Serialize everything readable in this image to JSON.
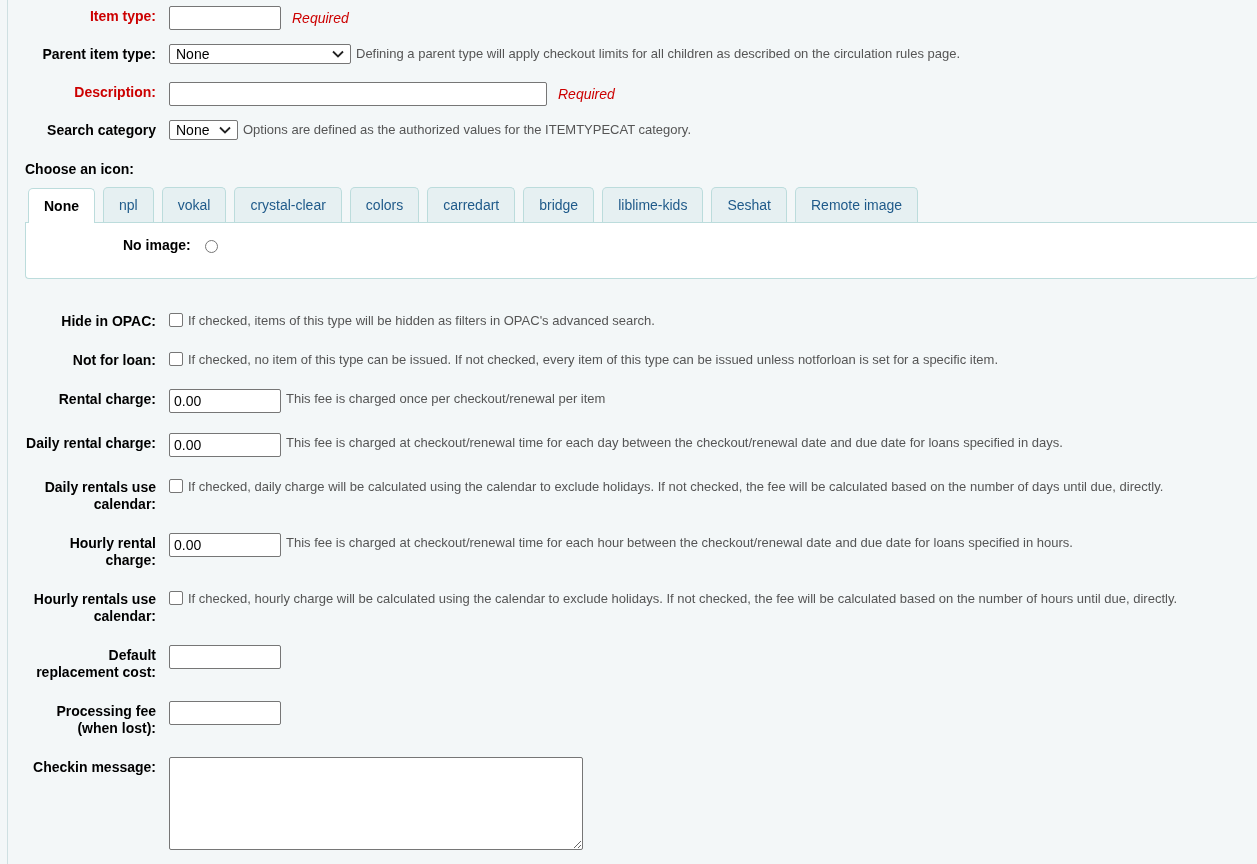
{
  "top_fields": [
    {
      "kind": "text",
      "label": "Item type:",
      "required": true,
      "note": "Required"
    },
    {
      "kind": "select",
      "label": "Parent item type:",
      "required": false,
      "value": "None",
      "hint": "Defining a parent type will apply checkout limits for all children as described on the circulation rules page."
    },
    {
      "kind": "text",
      "label": "Description:",
      "required": true,
      "note": "Required"
    },
    {
      "kind": "select",
      "label": "Search category",
      "required": false,
      "value": "None",
      "hint": "Options are defined as the authorized values for the ITEMTYPECAT category."
    }
  ],
  "icon_section": {
    "heading": "Choose an icon:",
    "tabs": [
      {
        "label": "None",
        "selected": true
      },
      {
        "label": "npl",
        "selected": false
      },
      {
        "label": "vokal",
        "selected": false
      },
      {
        "label": "crystal-clear",
        "selected": false
      },
      {
        "label": "colors",
        "selected": false
      },
      {
        "label": "carredart",
        "selected": false
      },
      {
        "label": "bridge",
        "selected": false
      },
      {
        "label": "liblime-kids",
        "selected": false
      },
      {
        "label": "Seshat",
        "selected": false
      },
      {
        "label": "Remote image",
        "selected": false
      }
    ],
    "radio": {
      "label": "No image:",
      "selected": false
    }
  },
  "fields": [
    {
      "kind": "checkbox",
      "label": "Hide in OPAC:",
      "checked": false,
      "hint": "If checked, items of this type will be hidden as filters in OPAC's advanced search."
    },
    {
      "kind": "checkbox",
      "label": "Not for loan:",
      "checked": false,
      "hint": "If checked, no item of this type can be issued. If not checked, every item of this type can be issued unless notforloan is set for a specific item."
    },
    {
      "kind": "text",
      "label": "Rental charge:",
      "value": "0.00",
      "hint": "This fee is charged once per checkout/renewal per item"
    },
    {
      "kind": "text",
      "label": "Daily rental charge:",
      "value": "0.00",
      "hint": "This fee is charged at checkout/renewal time for each day between the checkout/renewal date and due date for loans specified in days."
    },
    {
      "kind": "checkbox",
      "label": "Daily rentals use calendar:",
      "checked": false,
      "hint": "If checked, daily charge will be calculated using the calendar to exclude holidays. If not checked, the fee will be calculated based on the number of days until due, directly."
    },
    {
      "kind": "text",
      "label": "Hourly rental charge:",
      "value": "0.00",
      "hint": "This fee is charged at checkout/renewal time for each hour between the checkout/renewal date and due date for loans specified in hours."
    },
    {
      "kind": "checkbox",
      "label": "Hourly rentals use calendar:",
      "checked": false,
      "hint": "If checked, hourly charge will be calculated using the calendar to exclude holidays. If not checked, the fee will be calculated based on the number of hours until due, directly."
    },
    {
      "kind": "text",
      "label": "Default replacement cost:"
    },
    {
      "kind": "text",
      "label": "Processing fee (when lost):"
    },
    {
      "kind": "textarea",
      "label": "Checkin message:"
    }
  ]
}
